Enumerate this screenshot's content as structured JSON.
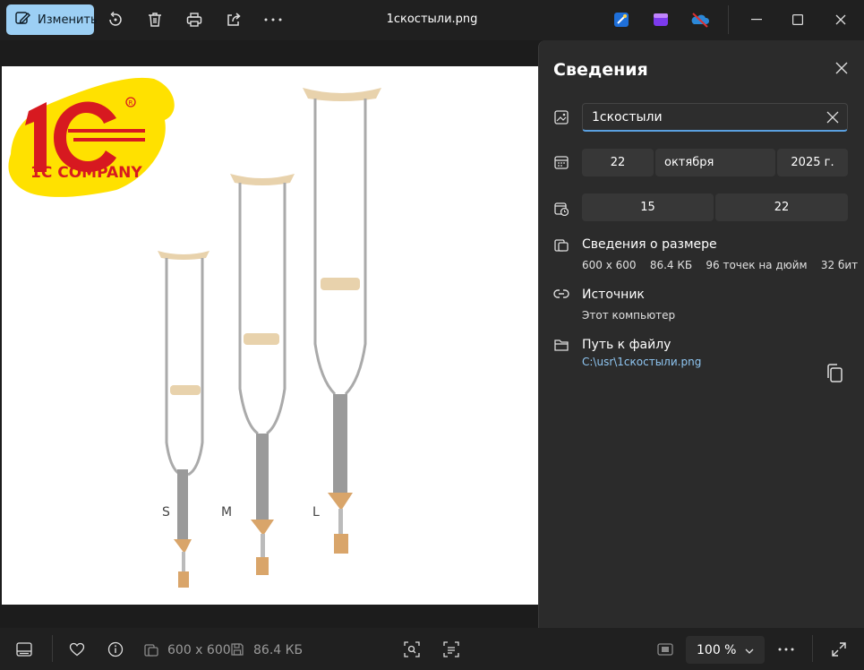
{
  "toolbar": {
    "edit_label": "Изменить",
    "file_title": "1скостыли.png"
  },
  "image": {
    "brand_text": "1C COMPANY",
    "size_labels": [
      "S",
      "M",
      "L"
    ]
  },
  "panel": {
    "title": "Сведения",
    "file_name": "1скостыли",
    "date": {
      "day": "22",
      "month": "октября",
      "year": "2025 г."
    },
    "time": {
      "hour": "15",
      "minute": "22"
    },
    "size_section": {
      "title": "Сведения о размере",
      "dimensions": "600 x 600",
      "file_size": "86.4 КБ",
      "dpi": "96 точек на дюйм",
      "bit_depth": "32 бит"
    },
    "source_section": {
      "title": "Источник",
      "value": "Этот компьютер"
    },
    "path_section": {
      "title": "Путь к файлу",
      "value": "C:\\usr\\1скостыли.png"
    }
  },
  "bottombar": {
    "dimensions": "600 x 600",
    "file_size": "86.4 КБ",
    "zoom": "100 %"
  },
  "colors": {
    "accent": "#9ccff4",
    "logo_yellow": "#ffe100",
    "logo_red": "#d71920",
    "link": "#8fc6f2"
  }
}
